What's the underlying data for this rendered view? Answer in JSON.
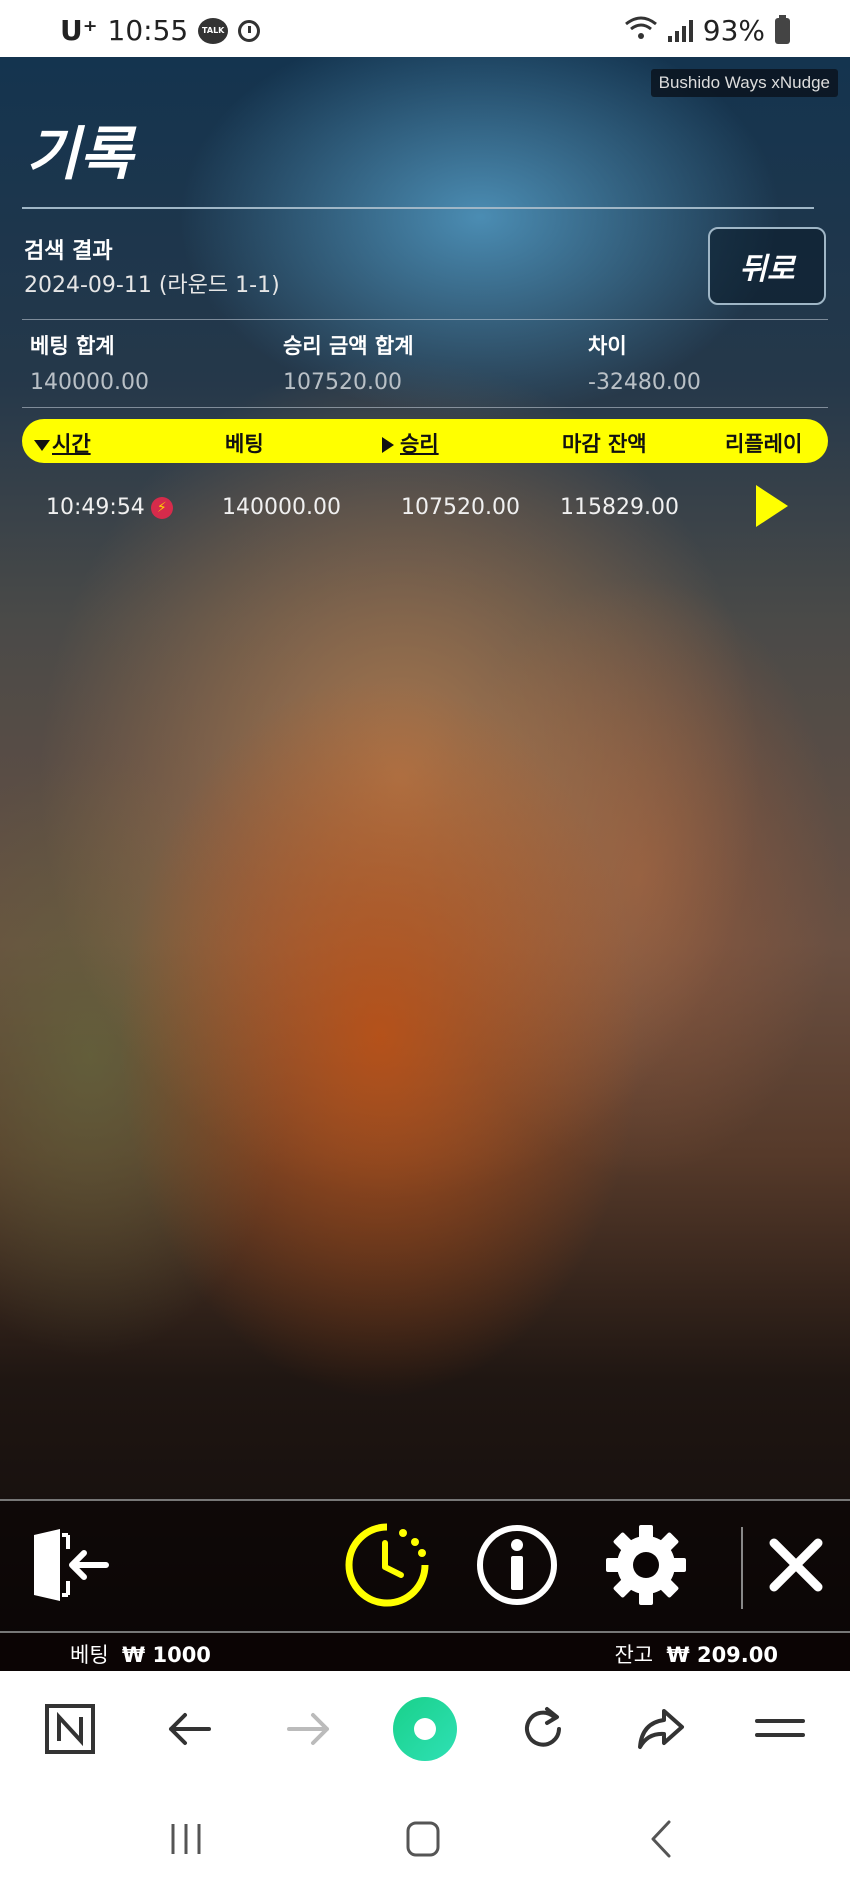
{
  "status": {
    "carrier": "U⁺",
    "time": "10:55",
    "talk_label": "TALK",
    "battery": "93%"
  },
  "brand": "Bushido Ways xNudge",
  "title": "기록",
  "search": {
    "label": "검색 결과",
    "value": "2024-09-11 (라운드 1-1)"
  },
  "back_label": "뒤로",
  "summary": {
    "bet_total_label": "베팅 합계",
    "bet_total": "140000.00",
    "win_total_label": "승리 금액 합계",
    "win_total": "107520.00",
    "diff_label": "차이",
    "diff": "-32480.00"
  },
  "table": {
    "headers": [
      "시간",
      "베팅",
      "승리",
      "마감 잔액",
      "리플레이"
    ],
    "rows": [
      {
        "time": "10:49:54",
        "bet": "140000.00",
        "win": "107520.00",
        "balance": "115829.00"
      }
    ]
  },
  "footer": {
    "bet_label": "베팅",
    "bet_value": "₩ 1000",
    "balance_label": "잔고",
    "balance_value": "₩ 209.00"
  },
  "icons": {
    "accent": "#ffff00",
    "toolbar": [
      "exit-icon",
      "history-icon",
      "info-icon",
      "settings-icon",
      "close-icon"
    ],
    "browser": [
      "naver-home-icon",
      "back-arrow-icon",
      "forward-arrow-icon",
      "green-dot-icon",
      "reload-icon",
      "share-icon",
      "menu-icon"
    ]
  }
}
